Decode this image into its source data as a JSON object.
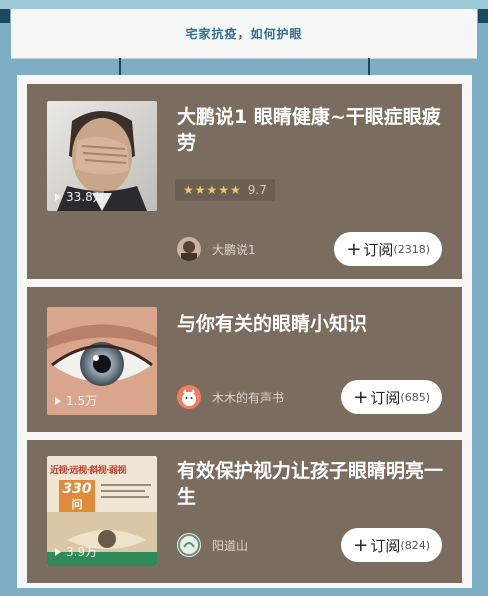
{
  "header": {
    "title": "宅家抗疫，如何护眼"
  },
  "cards": [
    {
      "title": "大鹏说1 眼睛健康~干眼症眼疲劳",
      "plays": "33.8万",
      "rating_stars": "★★★★★",
      "rating": "9.7",
      "author": "大鹏说1",
      "subscribe_label": "订阅",
      "subscribe_count": "(2318)"
    },
    {
      "title": "与你有关的眼睛小知识",
      "plays": "1.5万",
      "author": "木木的有声书",
      "subscribe_label": "订阅",
      "subscribe_count": "(685)"
    },
    {
      "title": "有效保护视力让孩子眼睛明亮一生",
      "plays": "3.9万",
      "cover_text": "近视·远视·斜视·弱视",
      "cover_number": "330",
      "cover_unit": "问",
      "author": "阳道山",
      "subscribe_label": "订阅",
      "subscribe_count": "(824)"
    }
  ]
}
